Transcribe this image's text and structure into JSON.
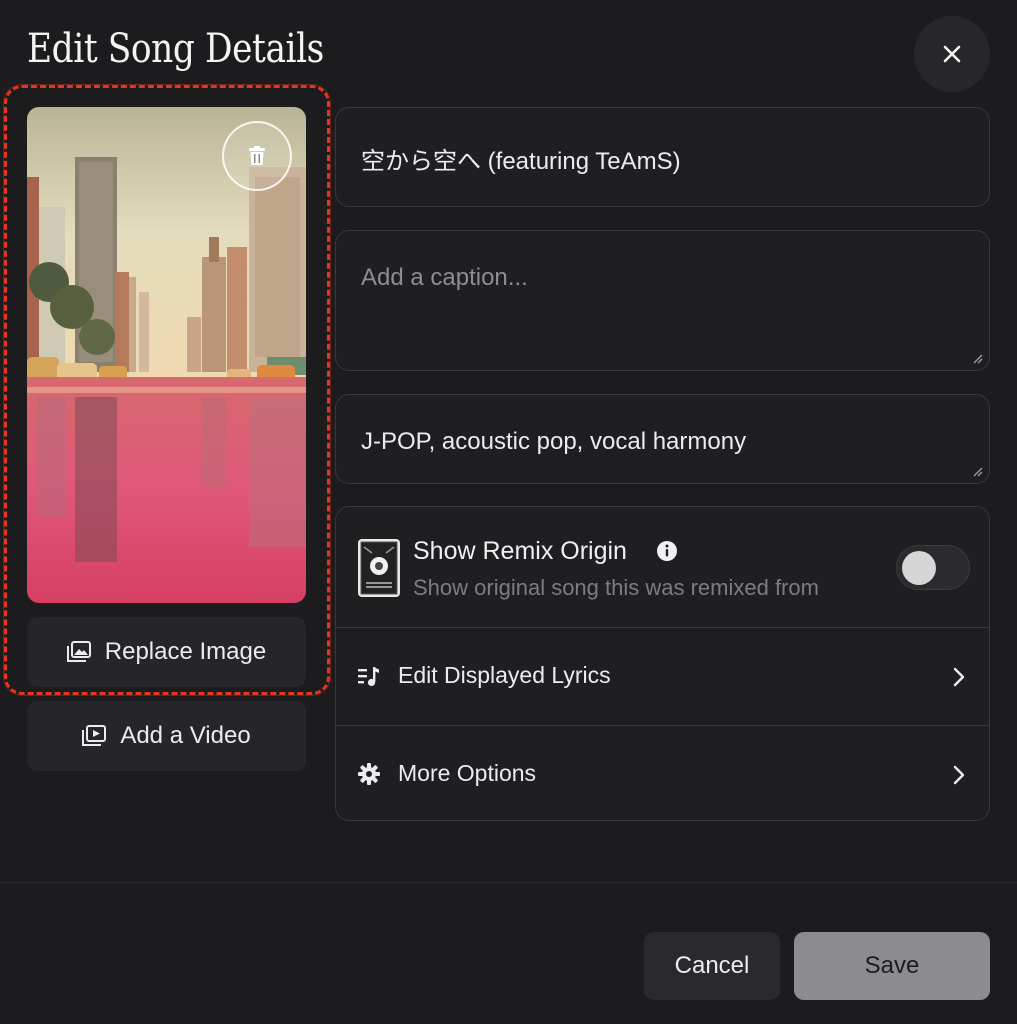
{
  "dialog": {
    "title": "Edit Song Details"
  },
  "cover": {
    "replace_label": "Replace Image",
    "video_label": "Add a Video"
  },
  "fields": {
    "title_value": "空から空へ (featuring TeAmS)",
    "caption_placeholder": "Add a caption...",
    "caption_value": "",
    "style_value": "J-POP, acoustic pop, vocal harmony"
  },
  "options": {
    "remix_title": "Show Remix Origin",
    "remix_subtitle": "Show original song this was remixed from",
    "remix_enabled": false,
    "lyrics_label": "Edit Displayed Lyrics",
    "more_label": "More Options"
  },
  "footer": {
    "cancel_label": "Cancel",
    "save_label": "Save"
  },
  "colors": {
    "background": "#1c1c1f",
    "highlight": "#e8331e",
    "save_disabled": "#8c8c8e"
  }
}
